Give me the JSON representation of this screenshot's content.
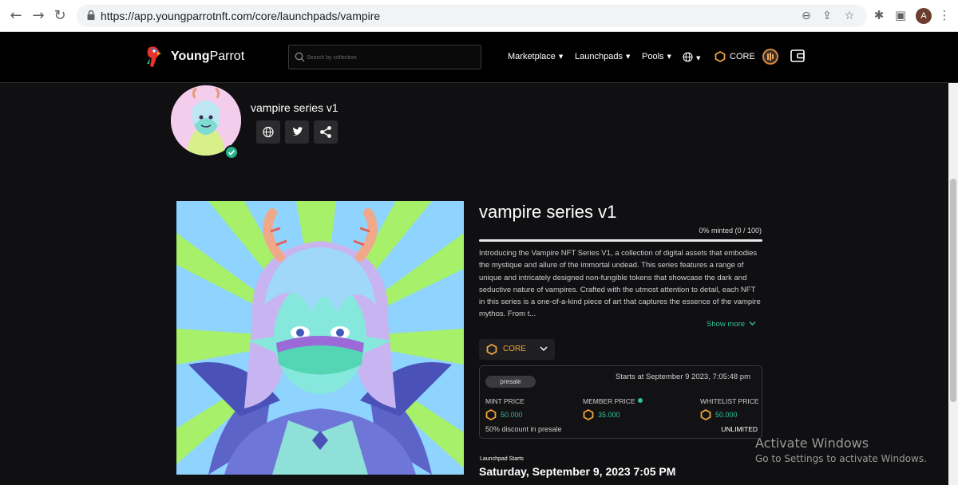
{
  "browser": {
    "url": "https://app.youngparrotnft.com/core/launchpads/vampire",
    "profile_initial": "A"
  },
  "header": {
    "brand_bold": "Young",
    "brand_regular": "Parrot",
    "search_placeholder": "Search by collection",
    "nav": [
      "Marketplace",
      "Launchpads",
      "Pools"
    ],
    "chain_label": "CORE"
  },
  "collection": {
    "name": "vampire series v1"
  },
  "launchpad": {
    "title": "vampire series v1",
    "minted_text": "0% minted (0 / 100)",
    "minted_fraction": 0,
    "description": "Introducing the Vampire NFT Series V1, a collection of digital assets that embodies the mystique and allure of the immortal undead. This series features a range of unique and intricately designed non-fungible tokens that showcase the dark and seductive nature of vampires. Crafted with the utmost attention to detail, each NFT in this series is a one-of-a-kind piece of art that captures the essence of the vampire mythos. From t...",
    "show_more": "Show more",
    "currency": "CORE",
    "phase": "presale",
    "starts_at": "Starts at September 9 2023, 7:05:48 pm",
    "prices": {
      "mint_label": "MINT PRICE",
      "mint_value": "50.000",
      "member_label": "MEMBER PRICE",
      "member_value": "35.000",
      "whitelist_label": "WHITELIST PRICE",
      "whitelist_value": "50.000"
    },
    "discount_text": "50% discount in presale",
    "limit_text": "UNLIMITED",
    "launch_label": "Launchpad Starts",
    "launch_date": "Saturday, September 9, 2023 7:05 PM"
  },
  "watermark": {
    "title": "Activate Windows",
    "subtitle": "Go to Settings to activate Windows."
  },
  "colors": {
    "accent_green": "#2fbf9a",
    "core_orange": "#f0a43b",
    "background": "#101012"
  }
}
